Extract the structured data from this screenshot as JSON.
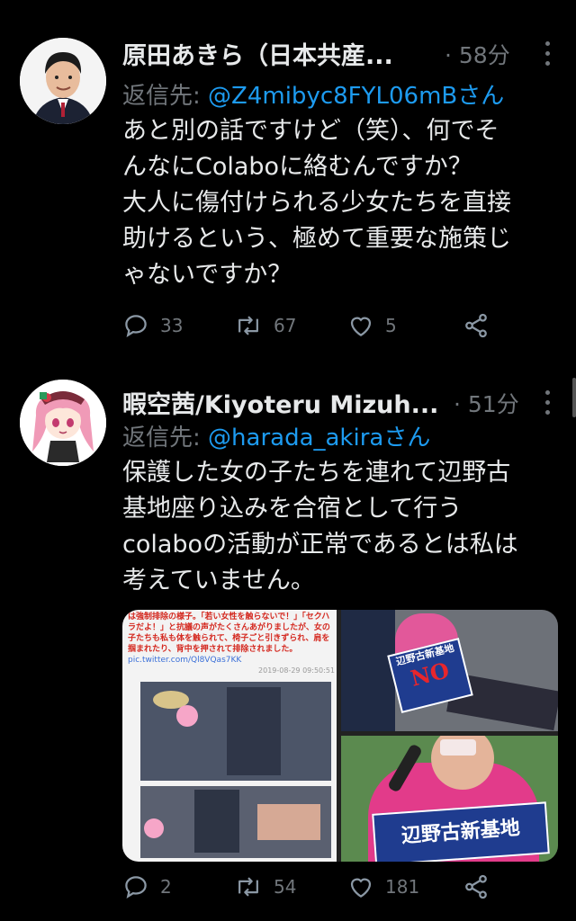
{
  "tweets": [
    {
      "author": "原田あきら（日本共産...",
      "time": "· 58分",
      "reply_prefix": "返信先: ",
      "reply_handle": "@Z4mibyc8FYL06mBさん",
      "lines": [
        "あと別の話ですけど（笑）、何でそ",
        "んなにColaboに絡むんですか？",
        "大人に傷付けられる少女たちを直接",
        "助けるという、極めて重要な施策じ",
        "ゃないですか？"
      ],
      "replies": "33",
      "retweets": "67",
      "likes": "5",
      "avatar_icon": "portrait-avatar-icon"
    },
    {
      "author": "暇空茜/Kiyoteru Mizuh...",
      "time": "· 51分",
      "reply_prefix": "返信先: ",
      "reply_handle": "@harada_akiraさん",
      "lines": [
        "保護した女の子たちを連れて辺野古",
        "基地座り込みを合宿として行う",
        "colaboの活動が正常であるとは私は",
        "考えていません。"
      ],
      "replies": "2",
      "retweets": "54",
      "likes": "181",
      "avatar_icon": "anime-girl-avatar-icon",
      "media": {
        "caption": "は強制排除の様子。「若い女性を触らないで！」「セクハラだよ！」と抗議の声がたくさんあがりましたが、女の子たちも私も体を触られて、椅子ごと引きずられ、肩を掴まれたり、背中を押されて排除されました。",
        "caption_link": "pic.twitter.com/Ql8VQas7KK",
        "caption_date": "2019-08-29 09:50:51",
        "sign_top": "辺野古新基地",
        "sign_no": "NO",
        "sign_bottom": "辺野古新基地"
      }
    }
  ],
  "colors": {
    "background": "#000000",
    "text": "#e7e9ea",
    "muted": "#71767b",
    "link": "#1d9bf0"
  }
}
